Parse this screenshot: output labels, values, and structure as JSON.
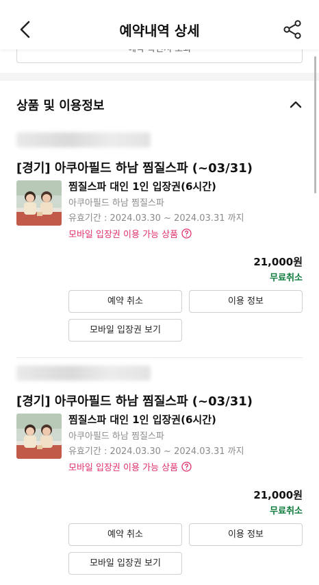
{
  "header": {
    "title": "예약내역 상세",
    "back_icon": "chevron-left-icon",
    "share_icon": "share-icon"
  },
  "prev_button": {
    "label": "예약 확인서 조회"
  },
  "section": {
    "title": "상품 및 이용정보",
    "toggle_icon": "chevron-up-icon"
  },
  "items": [
    {
      "name": "[경기] 아쿠아필드 하남 찜질스파 (~03/31)",
      "option": "찜질스파 대인 1인 입장권(6시간)",
      "place": "아쿠아필드 하남 찜질스파",
      "period": "유효기간 : 2024.03.30 ~ 2024.03.31 까지",
      "mobile_label": "모바일 입장권 이용 가능 상품",
      "price": "21,000원",
      "cancel_status": "무료취소",
      "btn_cancel": "예약 취소",
      "btn_info": "이용 정보",
      "btn_mobile": "모바일 입장권 보기"
    },
    {
      "name": "[경기] 아쿠아필드 하남 찜질스파 (~03/31)",
      "option": "찜질스파 대인 1인 입장권(6시간)",
      "place": "아쿠아필드 하남 찜질스파",
      "period": "유효기간 : 2024.03.30 ~ 2024.03.31 까지",
      "mobile_label": "모바일 입장권 이용 가능 상품",
      "price": "21,000원",
      "cancel_status": "무료취소",
      "btn_cancel": "예약 취소",
      "btn_info": "이용 정보",
      "btn_mobile": "모바일 입장권 보기"
    }
  ],
  "colors": {
    "pink": "#e0306a",
    "green": "#0c7a3a"
  }
}
